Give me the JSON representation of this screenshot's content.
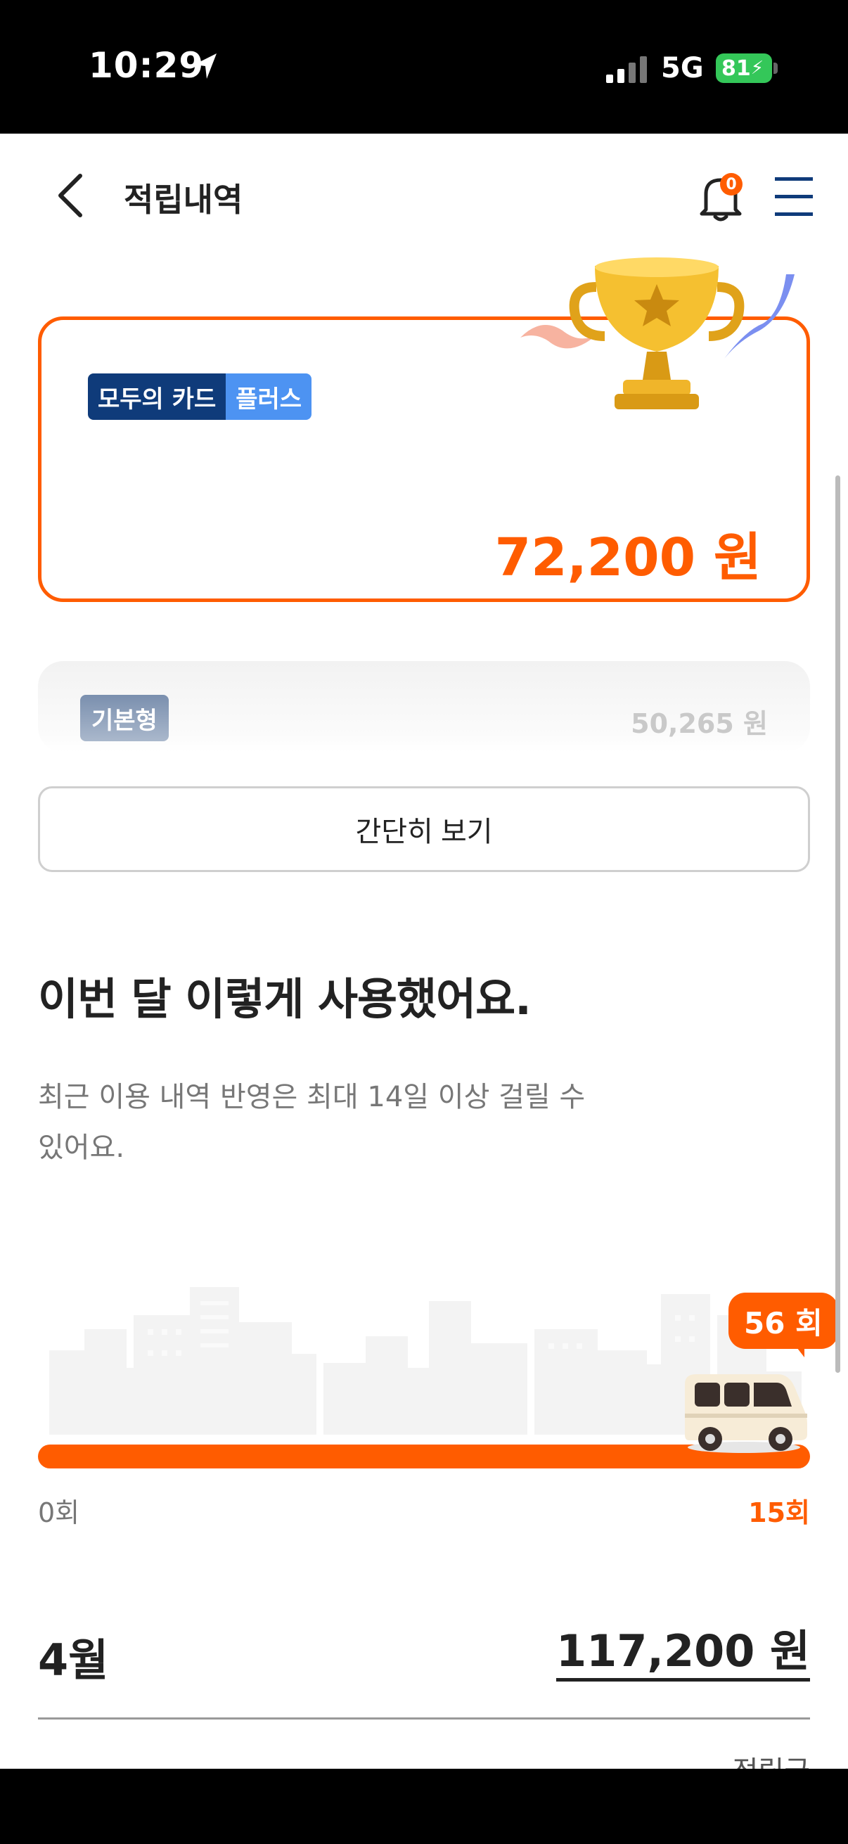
{
  "status_bar": {
    "time": "10:29",
    "network": "5G",
    "battery": "81"
  },
  "header": {
    "title": "적립내역",
    "notification_count": "0",
    "icons": [
      "back-arrow-icon",
      "bell-icon",
      "menu-icon"
    ]
  },
  "main_card": {
    "badge_primary": "모두의 카드",
    "badge_secondary": "플러스",
    "amount": "72,200 원",
    "accent_color": "#ff5c00"
  },
  "sub_card": {
    "badge": "기본형",
    "amount": "50,265 원"
  },
  "simple_view_button": "간단히 보기",
  "usage": {
    "title": "이번 달 이렇게 사용했어요.",
    "description": "최근 이용 내역 반영은 최대 14일 이상 걸릴 수 있어요.",
    "count_bubble": "56 회",
    "progress_min": "0회",
    "progress_max": "15회",
    "progress_fraction": 1.0
  },
  "month_summary": {
    "month": "4월",
    "amount": "117,200 원",
    "partial_label": "적립금"
  }
}
